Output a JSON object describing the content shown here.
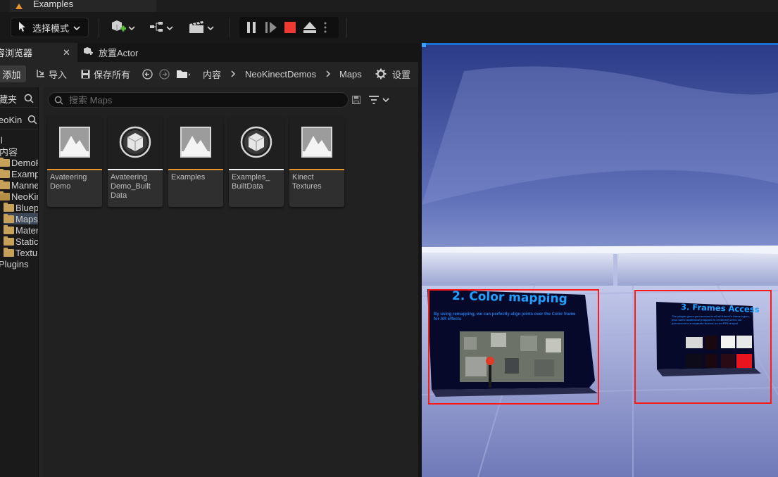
{
  "window": {
    "tab_title": "Examples"
  },
  "toolbar": {
    "mode_label": "选择模式",
    "icons": [
      "cube-add-icon",
      "blueprint-icon",
      "cinematics-icon",
      "pause-icon",
      "step-icon",
      "stop-icon",
      "eject-icon",
      "more-icon"
    ]
  },
  "content_browser": {
    "tab_label": "容浏览器",
    "tab_close": "✕",
    "second_tab_label": "放置Actor",
    "add_label": "添加",
    "import_label": "导入",
    "save_all_label": "保存所有",
    "breadcrumb": [
      "内容",
      "NeoKinectDemos",
      "Maps"
    ],
    "settings_label": "设置",
    "sources": {
      "favorites_label": "藏夹",
      "project_label": "eoKin",
      "tree": [
        {
          "label": "ll",
          "indent": 0,
          "folder": false
        },
        {
          "label": "内容",
          "indent": 1,
          "folder": false
        },
        {
          "label": "DemoR",
          "indent": 1,
          "folder": true
        },
        {
          "label": "Exampl",
          "indent": 1,
          "folder": true
        },
        {
          "label": "Manne",
          "indent": 1,
          "folder": true
        },
        {
          "label": "NeoKin",
          "indent": 1,
          "folder": true,
          "open": true
        },
        {
          "label": "Bluep",
          "indent": 2,
          "folder": true
        },
        {
          "label": "Maps",
          "indent": 2,
          "folder": true,
          "selected": true
        },
        {
          "label": "Mater",
          "indent": 2,
          "folder": true
        },
        {
          "label": "Static",
          "indent": 2,
          "folder": true
        },
        {
          "label": "Textu",
          "indent": 2,
          "folder": true
        },
        {
          "label": "Plugins",
          "indent": 0,
          "folder": false
        }
      ]
    },
    "search_placeholder": "搜索 Maps",
    "assets": [
      {
        "name": "Avateering Demo",
        "icon": "map-icon",
        "color": "#e8962a"
      },
      {
        "name": "Avateering Demo_Built Data",
        "icon": "cube-icon",
        "color": "#f2f2f2"
      },
      {
        "name": "Examples",
        "icon": "map-icon",
        "color": "#e8962a"
      },
      {
        "name": "Examples_ BuiltData",
        "icon": "cube-icon",
        "color": "#f2f2f2"
      },
      {
        "name": "Kinect Textures",
        "icon": "map-icon",
        "color": "#e8962a"
      }
    ]
  },
  "viewport": {
    "panel_left_title": "2. Color mapping",
    "panel_left_body": "By using remapping, we can perfectly align joints over the Color frame for AR effects",
    "panel_right_title": "3. Frames Access",
    "panel_right_body": "The plugin gives you access to all of Kinect's frame types, plus some additional (mapped in rendered) ones. All processed in a separate thread, so no FPS drops!",
    "highlight_color": "#ff1a1a"
  }
}
